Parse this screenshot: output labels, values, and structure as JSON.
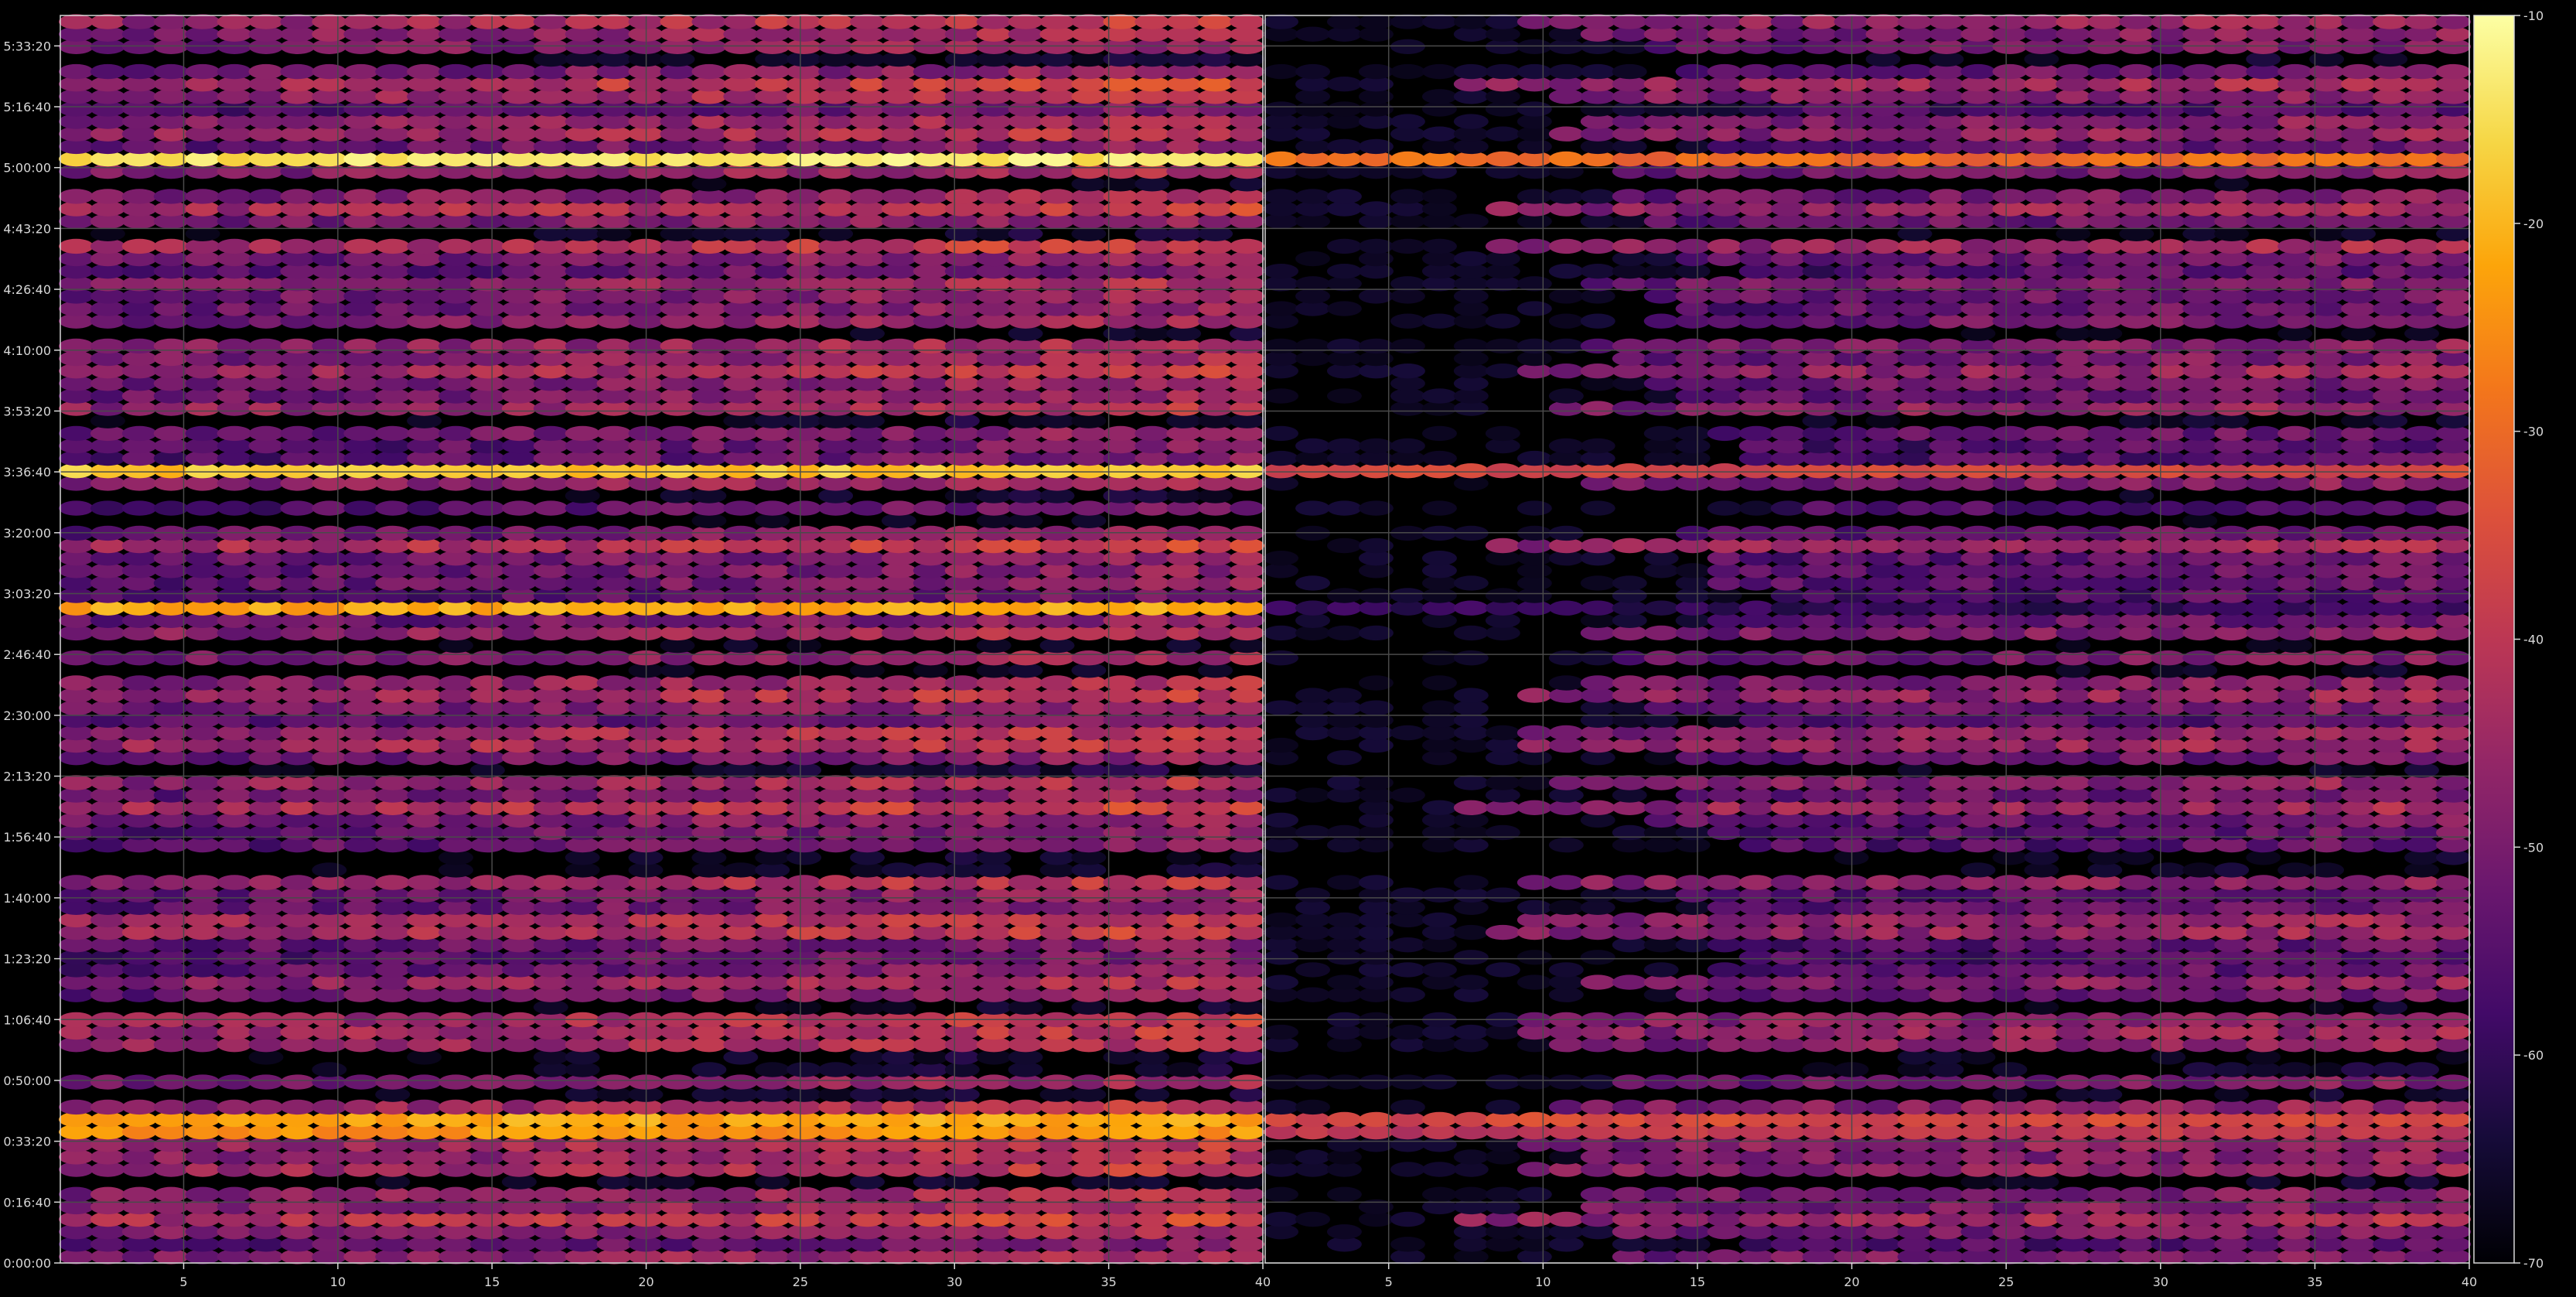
{
  "chart_data": {
    "type": "heatmap",
    "panels": [
      {
        "name": "",
        "x_ticks": [
          "5",
          "10",
          "15",
          "20",
          "25",
          "30",
          "35",
          "40"
        ],
        "x_range": [
          1,
          40
        ]
      },
      {
        "name": "",
        "x_ticks": [
          "5",
          "10",
          "15",
          "20",
          "25",
          "30",
          "35",
          "40"
        ],
        "x_range": [
          1,
          40
        ]
      }
    ],
    "y_ticks": [
      "0:00:00",
      "0:16:40",
      "0:33:20",
      "0:50:00",
      "1:06:40",
      "1:23:20",
      "1:40:00",
      "1:56:40",
      "2:13:20",
      "2:30:00",
      "2:46:40",
      "3:03:20",
      "3:20:00",
      "3:36:40",
      "3:53:20",
      "4:10:00",
      "4:26:40",
      "4:43:20",
      "5:00:00",
      "5:16:40",
      "5:33:20"
    ],
    "y_range_seconds": [
      0,
      20500
    ],
    "colorbar": {
      "colormap": "inferno",
      "range": [
        -70,
        -10
      ],
      "ticks": [
        "-70",
        "-60",
        "-50",
        "-40",
        "-30",
        "-20",
        "-10"
      ]
    },
    "grid": true,
    "strong_rows_dB": [
      {
        "time": "5:00:00",
        "left": -14,
        "right": -30
      },
      {
        "time": "3:36:40",
        "left": -18,
        "right": -36
      },
      {
        "time": "2:56:00",
        "left": -22,
        "right": -60
      },
      {
        "time": "0:37:00",
        "left": -22,
        "right": -36
      },
      {
        "time": "0:33:20",
        "left": -24,
        "right": -40
      }
    ]
  },
  "colors": {
    "background": "#000000",
    "grid": "#4a4a4a",
    "axis_text": "#d8d8d8"
  }
}
